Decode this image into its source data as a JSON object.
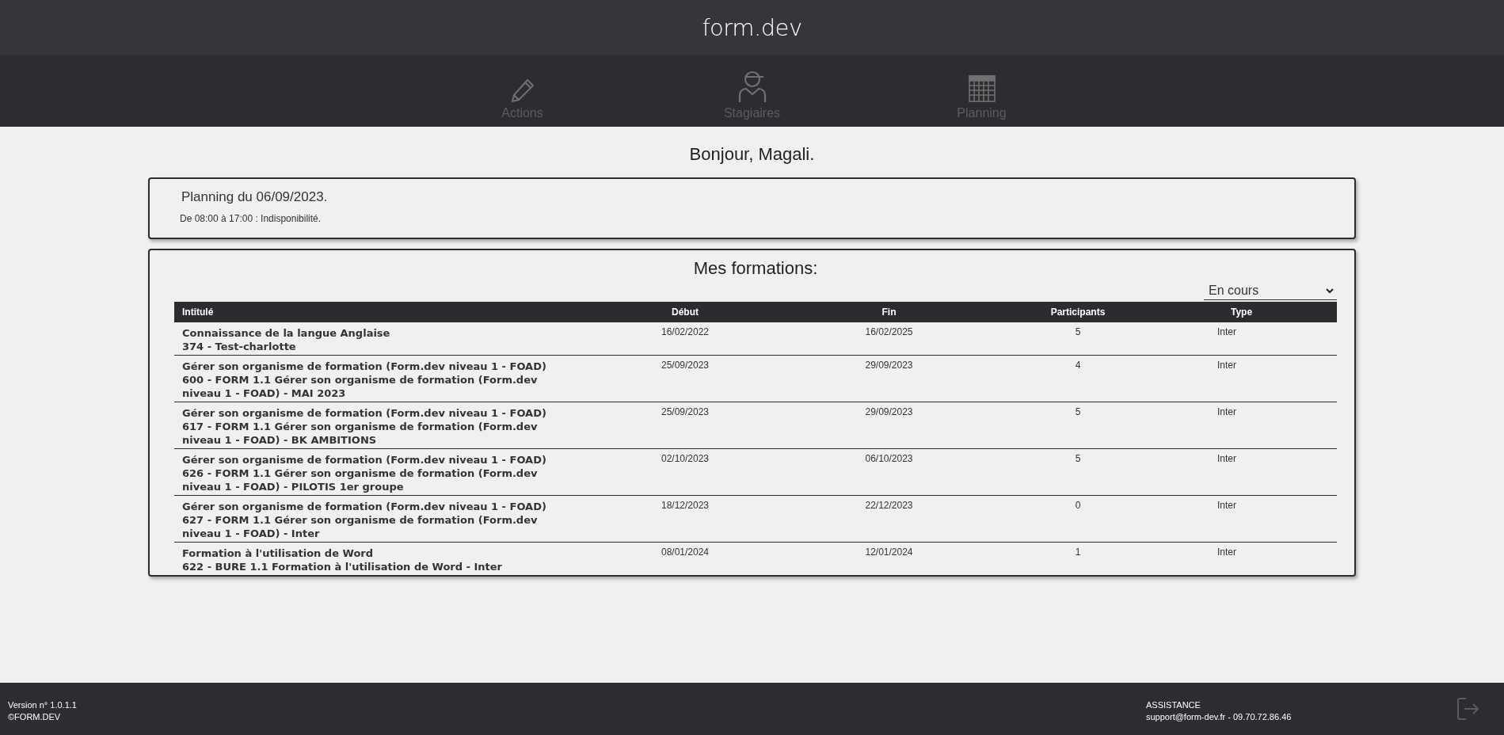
{
  "header": {
    "logo": "form.dev"
  },
  "nav": [
    {
      "label": "Actions",
      "kind": "actions",
      "selected": false
    },
    {
      "label": "Stagiaires",
      "kind": "trainees",
      "selected": false
    },
    {
      "label": "Planning",
      "kind": "planning",
      "selected": false
    }
  ],
  "greeting": "Bonjour, Magali.",
  "planning": {
    "title": "Planning du 06/09/2023.",
    "entries": [
      "De 08:00 à 17:00 : Indisponibilité."
    ]
  },
  "formations": {
    "title": "Mes formations:",
    "filter": "En cours",
    "columns": [
      "Intitulé",
      "Début",
      "Fin",
      "Participants",
      "Type"
    ],
    "rows": [
      {
        "title": "Connaissance de la langue Anglaise",
        "session": "374 - Test-charlotte",
        "start": "16/02/2022",
        "end": "16/02/2025",
        "participants": "5",
        "type": "Inter"
      },
      {
        "title": "Gérer son organisme de formation (Form.dev niveau 1 - FOAD)",
        "session": "600 - FORM 1.1 Gérer son organisme de formation (Form.dev niveau 1 - FOAD) - MAI 2023",
        "start": "25/09/2023",
        "end": "29/09/2023",
        "participants": "4",
        "type": "Inter"
      },
      {
        "title": "Gérer son organisme de formation (Form.dev niveau 1 - FOAD)",
        "session": "617 - FORM 1.1 Gérer son organisme de formation (Form.dev niveau 1 - FOAD) - BK AMBITIONS",
        "start": "25/09/2023",
        "end": "29/09/2023",
        "participants": "5",
        "type": "Inter"
      },
      {
        "title": "Gérer son organisme de formation (Form.dev niveau 1 - FOAD)",
        "session": "626 - FORM 1.1 Gérer son organisme de formation (Form.dev niveau 1 - FOAD) - PILOTIS 1er groupe",
        "start": "02/10/2023",
        "end": "06/10/2023",
        "participants": "5",
        "type": "Inter"
      },
      {
        "title": "Gérer son organisme de formation (Form.dev niveau 1 - FOAD)",
        "session": "627 - FORM 1.1 Gérer son organisme de formation (Form.dev niveau 1 - FOAD) - Inter",
        "start": "18/12/2023",
        "end": "22/12/2023",
        "participants": "0",
        "type": "Inter"
      },
      {
        "title": "Formation à l'utilisation de Word",
        "session": "622 - BURE 1.1 Formation à l'utilisation de Word - Inter",
        "start": "08/01/2024",
        "end": "12/01/2024",
        "participants": "1",
        "type": "Inter"
      }
    ]
  },
  "footer": {
    "version": "Version n° 1.0.1.1",
    "copyright": "©FORM.DEV",
    "assistance_title": "ASSISTANCE",
    "assistance_contact": "support@form-dev.fr - 09.70.72.86.46"
  }
}
